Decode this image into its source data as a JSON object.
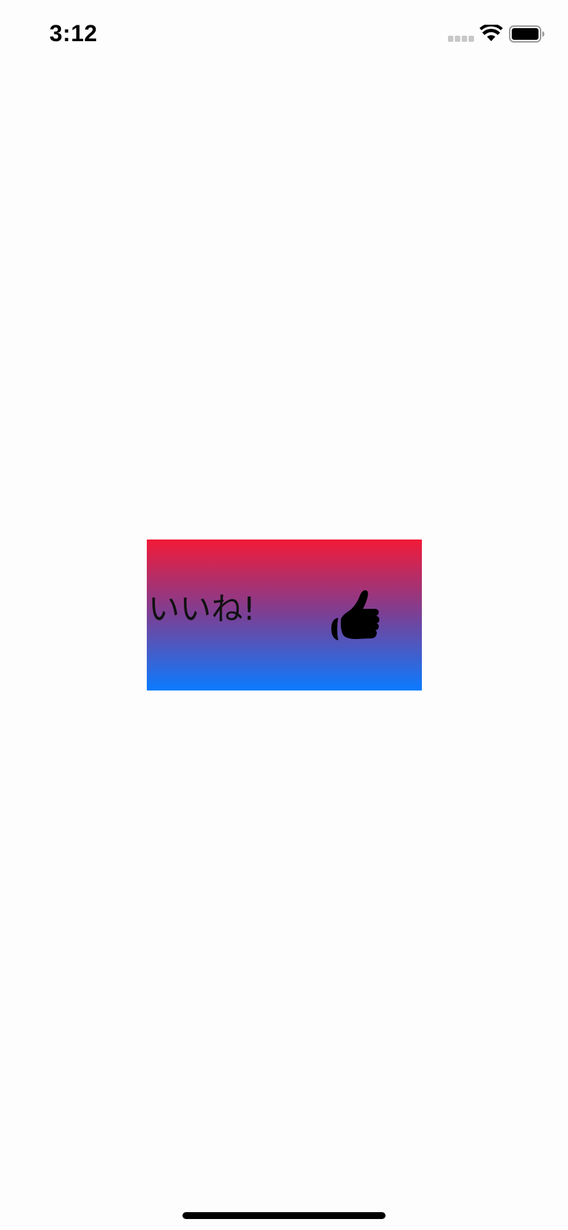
{
  "status_bar": {
    "time": "3:12",
    "icons": [
      "cellular-signal-icon",
      "wifi-icon",
      "battery-icon"
    ]
  },
  "main": {
    "like_button": {
      "label": "いいね!",
      "icon": "thumbs-up-icon",
      "gradient_colors": [
        "#f21a37",
        "#0b7bff"
      ]
    }
  },
  "colors": {
    "background": "#fdfdfd",
    "icon": "#000000",
    "text": "#111111"
  }
}
